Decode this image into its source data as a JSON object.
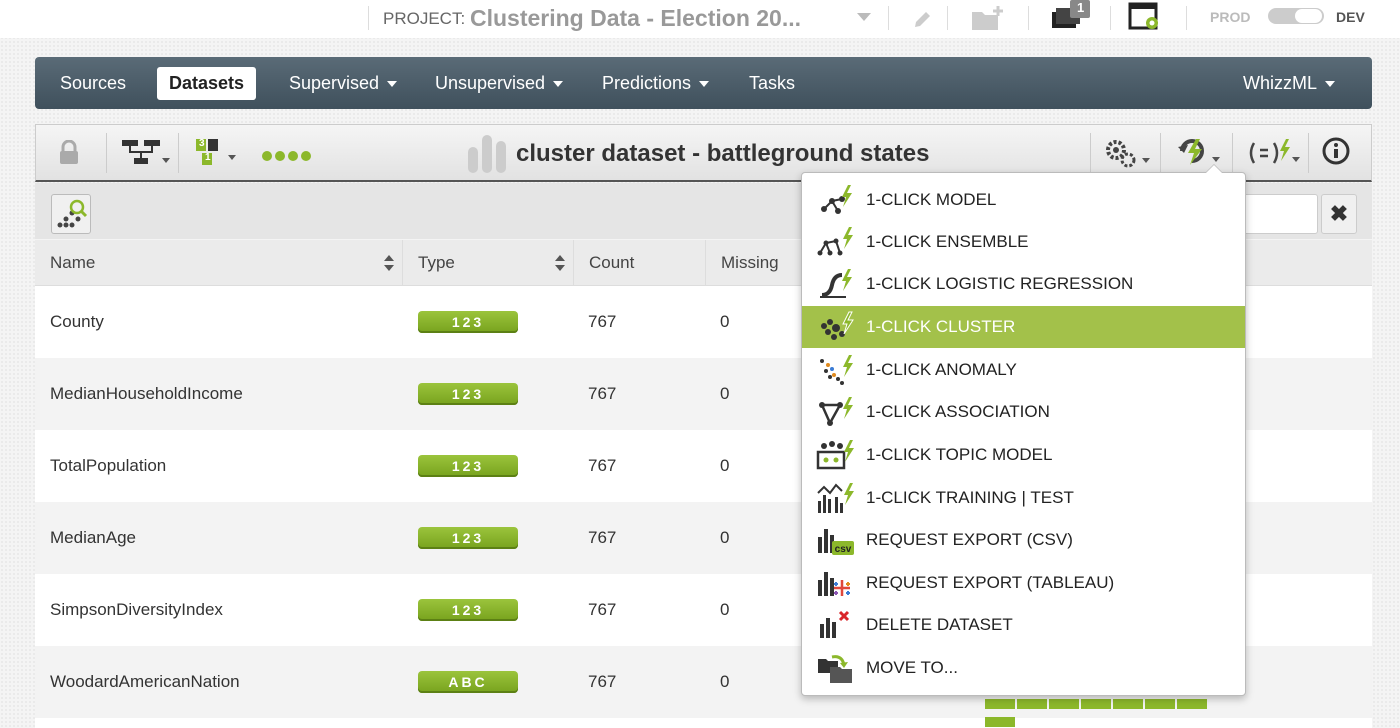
{
  "topbar": {
    "project_label": "PROJECT:",
    "project_name": "Clustering Data - Election 20...",
    "notification_count": "1",
    "env_prod": "PROD",
    "env_dev": "DEV"
  },
  "nav": {
    "items": [
      "Sources",
      "Datasets",
      "Supervised",
      "Unsupervised",
      "Predictions",
      "Tasks"
    ],
    "right": "WhizzML",
    "active": "Datasets"
  },
  "dataset": {
    "title": "cluster dataset - battleground states",
    "icon_num_top": "3",
    "icon_num_bottom": "1"
  },
  "table": {
    "headers": [
      "Name",
      "Type",
      "Count",
      "Missing"
    ],
    "rows": [
      {
        "name": "County",
        "type": "123",
        "count": "767",
        "missing": "0"
      },
      {
        "name": "MedianHouseholdIncome",
        "type": "123",
        "count": "767",
        "missing": "0"
      },
      {
        "name": "TotalPopulation",
        "type": "123",
        "count": "767",
        "missing": "0"
      },
      {
        "name": "MedianAge",
        "type": "123",
        "count": "767",
        "missing": "0"
      },
      {
        "name": "SimpsonDiversityIndex",
        "type": "123",
        "count": "767",
        "missing": "0"
      },
      {
        "name": "WoodardAmericanNation",
        "type": "ABC",
        "count": "767",
        "missing": "0"
      }
    ]
  },
  "dropdown": {
    "items": [
      {
        "label": "1-CLICK MODEL",
        "icon": "model-icon"
      },
      {
        "label": "1-CLICK ENSEMBLE",
        "icon": "ensemble-icon"
      },
      {
        "label": "1-CLICK LOGISTIC REGRESSION",
        "icon": "logistic-regression-icon"
      },
      {
        "label": "1-CLICK CLUSTER",
        "icon": "cluster-icon"
      },
      {
        "label": "1-CLICK ANOMALY",
        "icon": "anomaly-icon"
      },
      {
        "label": "1-CLICK ASSOCIATION",
        "icon": "association-icon"
      },
      {
        "label": "1-CLICK TOPIC MODEL",
        "icon": "topic-model-icon"
      },
      {
        "label": "1-CLICK TRAINING | TEST",
        "icon": "training-test-icon"
      },
      {
        "label": "REQUEST EXPORT (CSV)",
        "icon": "csv-export-icon"
      },
      {
        "label": "REQUEST EXPORT (TABLEAU)",
        "icon": "tableau-export-icon"
      },
      {
        "label": "DELETE DATASET",
        "icon": "delete-dataset-icon"
      },
      {
        "label": "MOVE TO...",
        "icon": "move-to-icon"
      }
    ],
    "highlighted": "1-CLICK CLUSTER",
    "csv_badge": "csv"
  },
  "colors": {
    "accent_green": "#8cb82b",
    "highlight_green": "#a3c14a",
    "nav_dark": "#4a5b67"
  }
}
